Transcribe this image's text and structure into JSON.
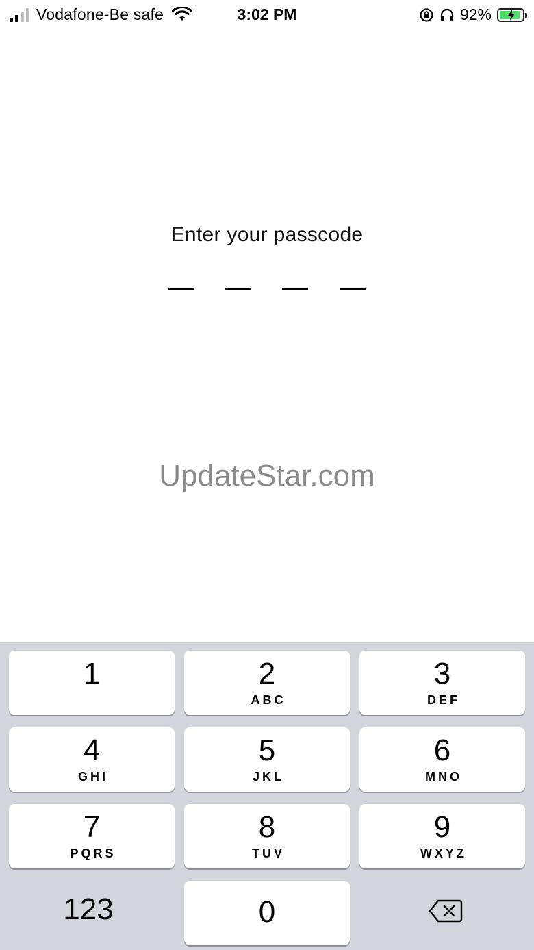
{
  "status_bar": {
    "carrier": "Vodafone-Be safe",
    "time": "3:02 PM",
    "battery_percent_label": "92%",
    "battery_level": 0.92
  },
  "passcode": {
    "prompt": "Enter your passcode",
    "digit_slots": 4
  },
  "watermark": "UpdateStar.com",
  "keypad": {
    "keys": [
      {
        "digit": "1",
        "letters": ""
      },
      {
        "digit": "2",
        "letters": "ABC"
      },
      {
        "digit": "3",
        "letters": "DEF"
      },
      {
        "digit": "4",
        "letters": "GHI"
      },
      {
        "digit": "5",
        "letters": "JKL"
      },
      {
        "digit": "6",
        "letters": "MNO"
      },
      {
        "digit": "7",
        "letters": "PQRS"
      },
      {
        "digit": "8",
        "letters": "TUV"
      },
      {
        "digit": "9",
        "letters": "WXYZ"
      },
      {
        "digit": "0",
        "letters": ""
      }
    ],
    "mode_switch_label": "123",
    "delete_icon": "backspace-icon"
  },
  "icons": {
    "signal": "cellular-signal-icon",
    "wifi": "wifi-icon",
    "rotation_lock": "rotation-lock-icon",
    "headphones": "headphones-icon",
    "battery": "battery-charging-icon"
  },
  "colors": {
    "keypad_background": "#d2d5db",
    "key_background": "#ffffff",
    "battery_fill": "#4cd964",
    "watermark": "#8a8a8a"
  }
}
